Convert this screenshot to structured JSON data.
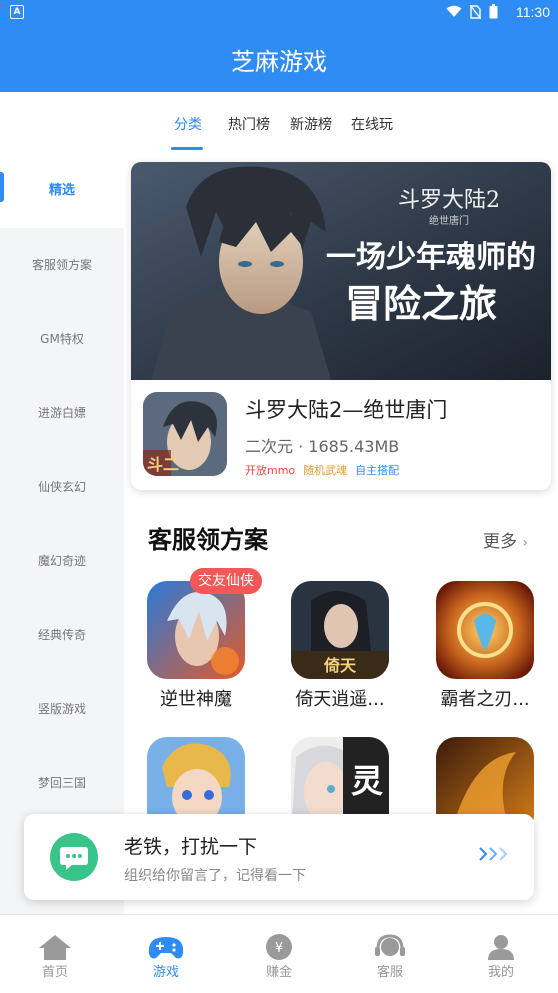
{
  "status_bar": {
    "time": "11:30"
  },
  "header": {
    "title": "芝麻游戏"
  },
  "tabs": [
    {
      "label": "分类",
      "active": true
    },
    {
      "label": "热门榜",
      "active": false
    },
    {
      "label": "新游榜",
      "active": false
    },
    {
      "label": "在线玩",
      "active": false
    }
  ],
  "sidebar": {
    "items": [
      {
        "label": "精选",
        "active": true
      },
      {
        "label": "客服领方案"
      },
      {
        "label": "GM特权"
      },
      {
        "label": "进游白嫖"
      },
      {
        "label": "仙侠玄幻"
      },
      {
        "label": "魔幻奇迹"
      },
      {
        "label": "经典传奇"
      },
      {
        "label": "竖版游戏"
      },
      {
        "label": "梦回三国"
      }
    ]
  },
  "featured": {
    "banner_logo": "斗罗大陆2",
    "banner_subtitle": "绝世唐门",
    "banner_slogan_1": "一场少年魂师的",
    "banner_slogan_2": "冒险之旅",
    "icon_text": "斗二",
    "name": "斗罗大陆2—绝世唐门",
    "category": "二次元",
    "separator": "·",
    "size": "1685.43MB",
    "tags": [
      {
        "label": "开放mmo",
        "color": "#e8483f"
      },
      {
        "label": "随机武魂",
        "color": "#e39a2b"
      },
      {
        "label": "自主搭配",
        "color": "#2f8cf5"
      }
    ]
  },
  "section": {
    "title": "客服领方案",
    "more_label": "更多",
    "badge": "交友仙侠",
    "apps": [
      {
        "name": "逆世神魔"
      },
      {
        "name": "倚天逍遥..."
      },
      {
        "name": "霸者之刃..."
      },
      {
        "name": ""
      },
      {
        "name": "",
        "icon_text": "灵"
      },
      {
        "name": ""
      }
    ]
  },
  "notice": {
    "title": "老铁，打扰一下",
    "subtitle": "组织给你留言了，记得看一下"
  },
  "bottom_nav": [
    {
      "label": "首页",
      "icon": "home-icon"
    },
    {
      "label": "游戏",
      "icon": "gamepad-icon",
      "active": true
    },
    {
      "label": "赚金",
      "icon": "coin-icon"
    },
    {
      "label": "客服",
      "icon": "headset-icon"
    },
    {
      "label": "我的",
      "icon": "user-icon"
    }
  ],
  "colors": {
    "primary": "#2f8cf5",
    "badge": "#f45757",
    "notice_green": "#39c58a"
  }
}
